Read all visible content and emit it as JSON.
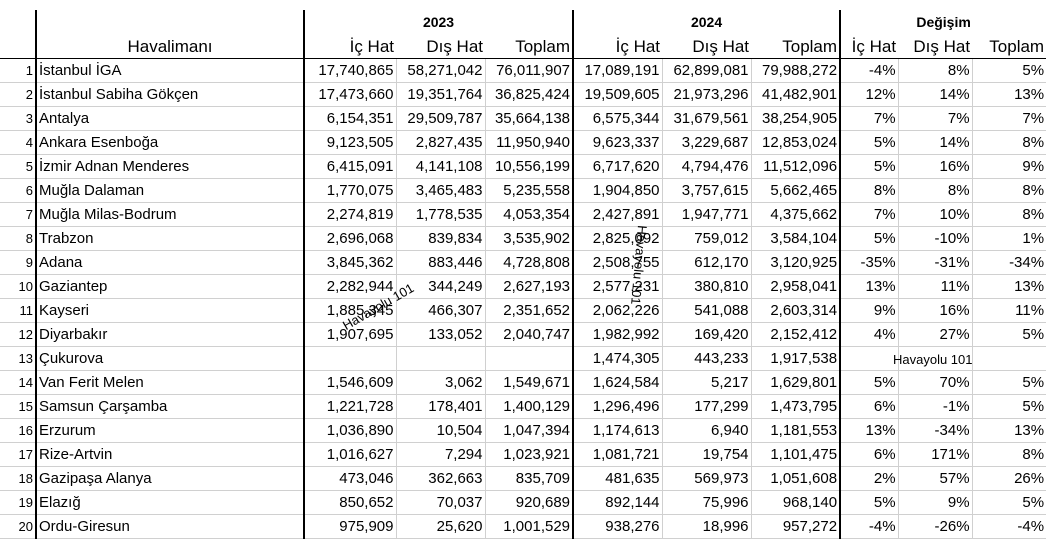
{
  "header": {
    "airport_label": "Havalimanı",
    "group_2023": "2023",
    "group_2024": "2024",
    "group_change": "Değişim",
    "col_domestic": "İç Hat",
    "col_international": "Dış Hat",
    "col_total": "Toplam"
  },
  "rows": [
    {
      "n": "1",
      "name": "İstanbul İGA",
      "d23": "17,740,865",
      "i23": "58,271,042",
      "t23": "76,011,907",
      "d24": "17,089,191",
      "i24": "62,899,081",
      "t24": "79,988,272",
      "cd": "-4%",
      "ci": "8%",
      "ct": "5%"
    },
    {
      "n": "2",
      "name": "İstanbul Sabiha Gökçen",
      "d23": "17,473,660",
      "i23": "19,351,764",
      "t23": "36,825,424",
      "d24": "19,509,605",
      "i24": "21,973,296",
      "t24": "41,482,901",
      "cd": "12%",
      "ci": "14%",
      "ct": "13%"
    },
    {
      "n": "3",
      "name": "Antalya",
      "d23": "6,154,351",
      "i23": "29,509,787",
      "t23": "35,664,138",
      "d24": "6,575,344",
      "i24": "31,679,561",
      "t24": "38,254,905",
      "cd": "7%",
      "ci": "7%",
      "ct": "7%"
    },
    {
      "n": "4",
      "name": "Ankara Esenboğa",
      "d23": "9,123,505",
      "i23": "2,827,435",
      "t23": "11,950,940",
      "d24": "9,623,337",
      "i24": "3,229,687",
      "t24": "12,853,024",
      "cd": "5%",
      "ci": "14%",
      "ct": "8%"
    },
    {
      "n": "5",
      "name": "İzmir Adnan Menderes",
      "d23": "6,415,091",
      "i23": "4,141,108",
      "t23": "10,556,199",
      "d24": "6,717,620",
      "i24": "4,794,476",
      "t24": "11,512,096",
      "cd": "5%",
      "ci": "16%",
      "ct": "9%"
    },
    {
      "n": "6",
      "name": "Muğla Dalaman",
      "d23": "1,770,075",
      "i23": "3,465,483",
      "t23": "5,235,558",
      "d24": "1,904,850",
      "i24": "3,757,615",
      "t24": "5,662,465",
      "cd": "8%",
      "ci": "8%",
      "ct": "8%"
    },
    {
      "n": "7",
      "name": "Muğla Milas-Bodrum",
      "d23": "2,274,819",
      "i23": "1,778,535",
      "t23": "4,053,354",
      "d24": "2,427,891",
      "i24": "1,947,771",
      "t24": "4,375,662",
      "cd": "7%",
      "ci": "10%",
      "ct": "8%"
    },
    {
      "n": "8",
      "name": "Trabzon",
      "d23": "2,696,068",
      "i23": "839,834",
      "t23": "3,535,902",
      "d24": "2,825,092",
      "i24": "759,012",
      "t24": "3,584,104",
      "cd": "5%",
      "ci": "-10%",
      "ct": "1%"
    },
    {
      "n": "9",
      "name": "Adana",
      "d23": "3,845,362",
      "i23": "883,446",
      "t23": "4,728,808",
      "d24": "2,508,755",
      "i24": "612,170",
      "t24": "3,120,925",
      "cd": "-35%",
      "ci": "-31%",
      "ct": "-34%"
    },
    {
      "n": "10",
      "name": "Gaziantep",
      "d23": "2,282,944",
      "i23": "344,249",
      "t23": "2,627,193",
      "d24": "2,577,231",
      "i24": "380,810",
      "t24": "2,958,041",
      "cd": "13%",
      "ci": "11%",
      "ct": "13%"
    },
    {
      "n": "11",
      "name": "Kayseri",
      "d23": "1,885,345",
      "i23": "466,307",
      "t23": "2,351,652",
      "d24": "2,062,226",
      "i24": "541,088",
      "t24": "2,603,314",
      "cd": "9%",
      "ci": "16%",
      "ct": "11%"
    },
    {
      "n": "12",
      "name": "Diyarbakır",
      "d23": "1,907,695",
      "i23": "133,052",
      "t23": "2,040,747",
      "d24": "1,982,992",
      "i24": "169,420",
      "t24": "2,152,412",
      "cd": "4%",
      "ci": "27%",
      "ct": "5%"
    },
    {
      "n": "13",
      "name": "Çukurova",
      "d23": "",
      "i23": "",
      "t23": "",
      "d24": "1,474,305",
      "i24": "443,233",
      "t24": "1,917,538",
      "cd": "",
      "ci": "",
      "ct": ""
    },
    {
      "n": "14",
      "name": "Van Ferit Melen",
      "d23": "1,546,609",
      "i23": "3,062",
      "t23": "1,549,671",
      "d24": "1,624,584",
      "i24": "5,217",
      "t24": "1,629,801",
      "cd": "5%",
      "ci": "70%",
      "ct": "5%"
    },
    {
      "n": "15",
      "name": "Samsun Çarşamba",
      "d23": "1,221,728",
      "i23": "178,401",
      "t23": "1,400,129",
      "d24": "1,296,496",
      "i24": "177,299",
      "t24": "1,473,795",
      "cd": "6%",
      "ci": "-1%",
      "ct": "5%"
    },
    {
      "n": "16",
      "name": "Erzurum",
      "d23": "1,036,890",
      "i23": "10,504",
      "t23": "1,047,394",
      "d24": "1,174,613",
      "i24": "6,940",
      "t24": "1,181,553",
      "cd": "13%",
      "ci": "-34%",
      "ct": "13%"
    },
    {
      "n": "17",
      "name": "Rize-Artvin",
      "d23": "1,016,627",
      "i23": "7,294",
      "t23": "1,023,921",
      "d24": "1,081,721",
      "i24": "19,754",
      "t24": "1,101,475",
      "cd": "6%",
      "ci": "171%",
      "ct": "8%"
    },
    {
      "n": "18",
      "name": "Gazipaşa Alanya",
      "d23": "473,046",
      "i23": "362,663",
      "t23": "835,709",
      "d24": "481,635",
      "i24": "569,973",
      "t24": "1,051,608",
      "cd": "2%",
      "ci": "57%",
      "ct": "26%"
    },
    {
      "n": "19",
      "name": "Elazığ",
      "d23": "850,652",
      "i23": "70,037",
      "t23": "920,689",
      "d24": "892,144",
      "i24": "75,996",
      "t24": "968,140",
      "cd": "5%",
      "ci": "9%",
      "ct": "5%"
    },
    {
      "n": "20",
      "name": "Ordu-Giresun",
      "d23": "975,909",
      "i23": "25,620",
      "t23": "1,001,529",
      "d24": "938,276",
      "i24": "18,996",
      "t24": "957,272",
      "cd": "-4%",
      "ci": "-26%",
      "ct": "-4%"
    }
  ],
  "watermarks": {
    "wm1": "Havayolu 101",
    "wm2": "Havayolu 101",
    "wm3": "Havayolu 101"
  }
}
